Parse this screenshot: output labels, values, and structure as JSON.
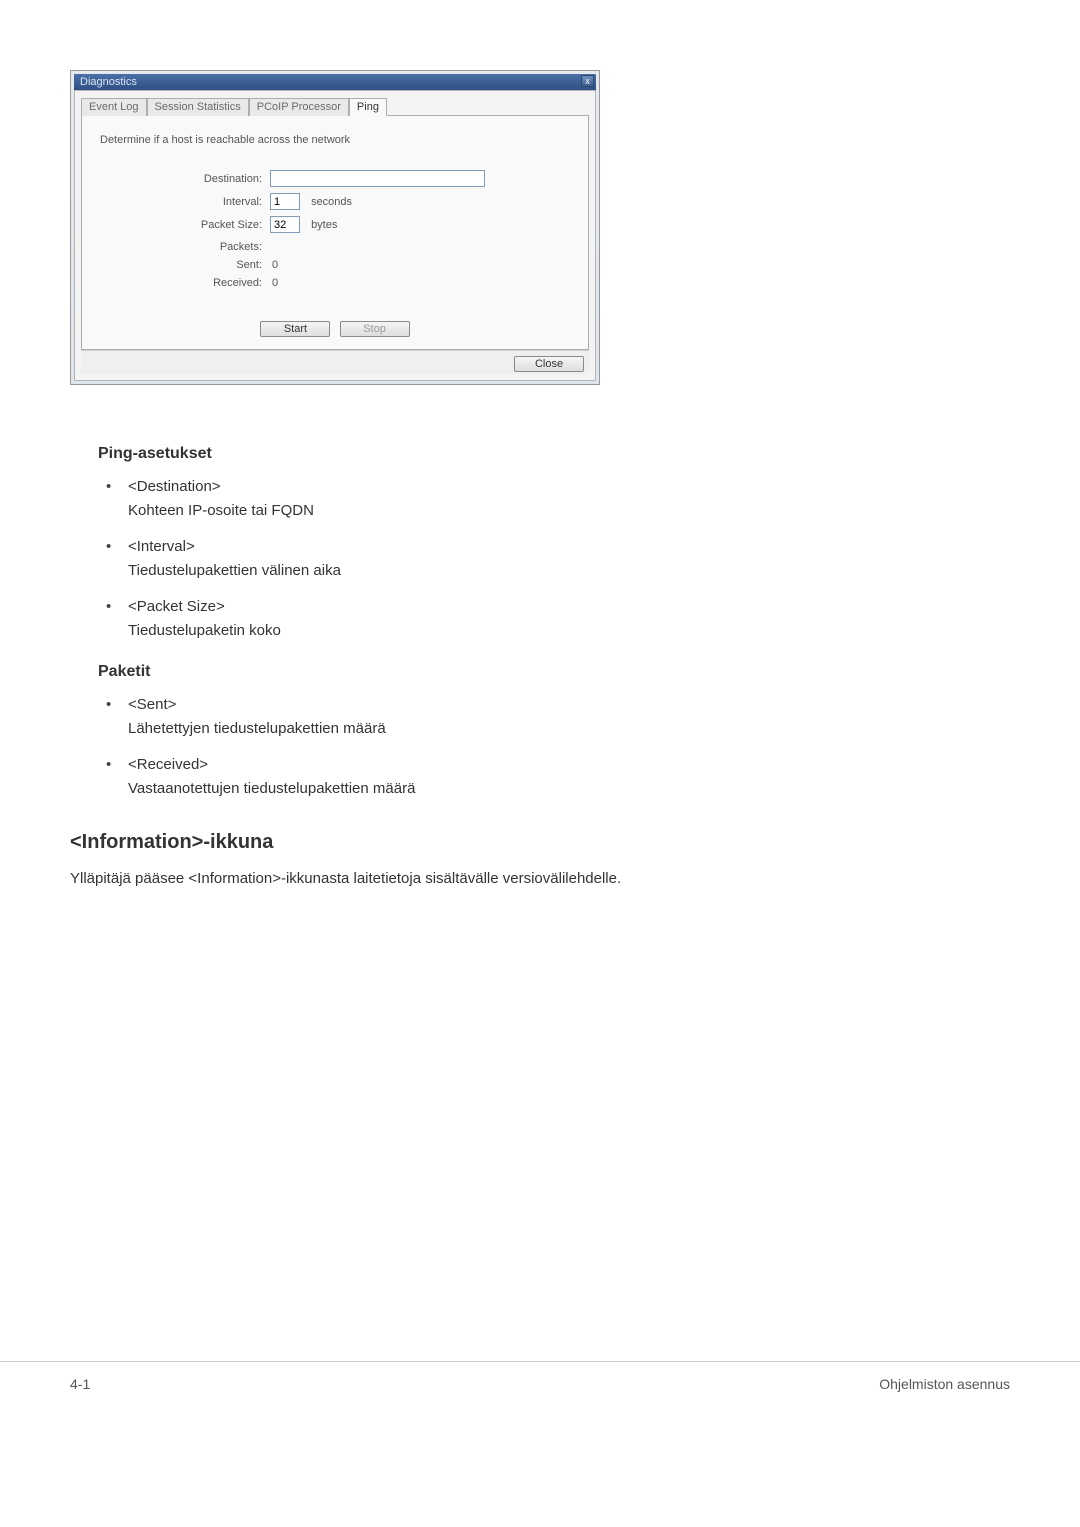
{
  "dialog": {
    "title": "Diagnostics",
    "close_x": "x",
    "tabs": [
      "Event Log",
      "Session Statistics",
      "PCoIP Processor",
      "Ping"
    ],
    "active_tab_index": 3,
    "description": "Determine if a host is reachable across the network",
    "fields": {
      "destination_label": "Destination:",
      "destination_value": "",
      "interval_label": "Interval:",
      "interval_value": "1",
      "interval_unit": "seconds",
      "packetsize_label": "Packet Size:",
      "packetsize_value": "32",
      "packetsize_unit": "bytes",
      "packets_label": "Packets:",
      "sent_label": "Sent:",
      "sent_value": "0",
      "received_label": "Received:",
      "received_value": "0"
    },
    "buttons": {
      "start": "Start",
      "stop": "Stop",
      "close": "Close"
    }
  },
  "doc": {
    "section1_title": "Ping-asetukset",
    "items1": [
      {
        "term": "<Destination>",
        "def": "Kohteen IP-osoite tai FQDN"
      },
      {
        "term": "<Interval>",
        "def": "Tiedustelupakettien välinen aika"
      },
      {
        "term": "<Packet Size>",
        "def": "Tiedustelupaketin koko"
      }
    ],
    "section2_title": "Paketit",
    "items2": [
      {
        "term": "<Sent>",
        "def": "Lähetettyjen tiedustelupakettien määrä"
      },
      {
        "term": "<Received>",
        "def": "Vastaanotettujen tiedustelupakettien määrä"
      }
    ],
    "heading2": "<Information>-ikkuna",
    "paragraph": "Ylläpitäjä pääsee <Information>-ikkunasta laitetietoja sisältävälle versiovälilehdelle."
  },
  "footer": {
    "left": "4-1",
    "right": "Ohjelmiston asennus"
  }
}
